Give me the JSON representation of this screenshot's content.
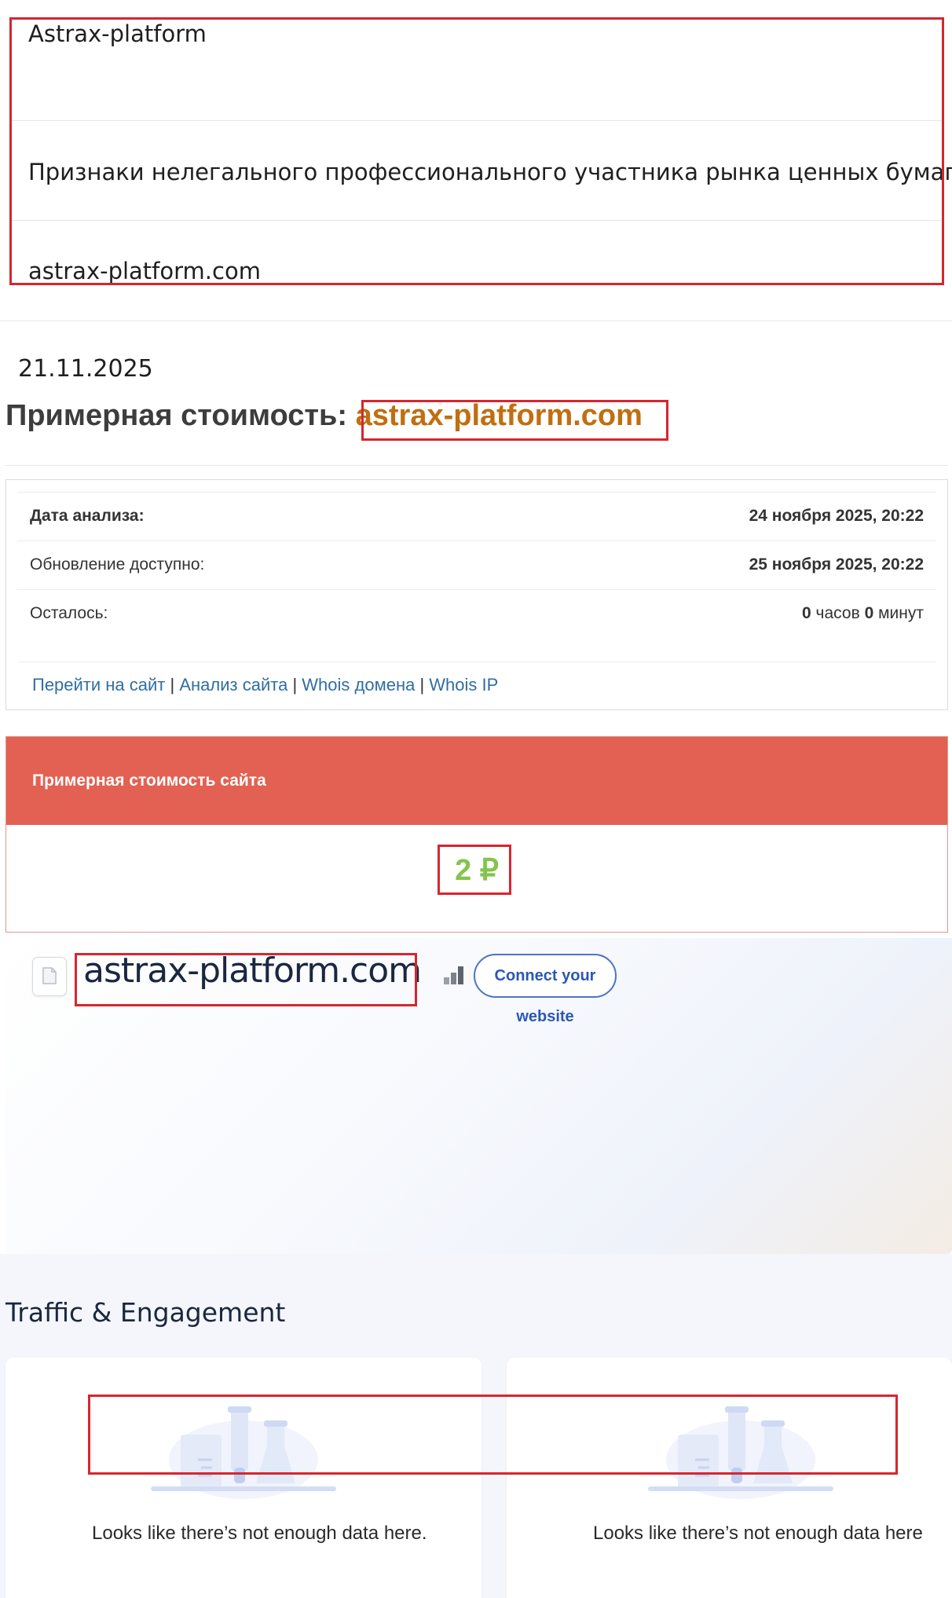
{
  "info": {
    "name": "Astrax-platform",
    "reason": "Признаки нелегального профессионального участника рынка ценных бумаг",
    "domain": "astrax-platform.com"
  },
  "post": {
    "date": "21.11.2025",
    "heading_prefix": "Примерная стоимость: ",
    "heading_domain": "astrax-platform.com"
  },
  "analysis": {
    "rows": [
      {
        "label": "Дата анализа:",
        "value": "24 ноября 2025, 20:22"
      },
      {
        "label": "Обновление доступно:",
        "value": "25 ноября 2025, 20:22"
      },
      {
        "label": "Осталось:",
        "hours_num": "0",
        "hours_word": " часов ",
        "minutes_num": "0",
        "minutes_word": " минут"
      }
    ],
    "links": [
      "Перейти на сайт",
      "Анализ сайта",
      "Whois домена",
      "Whois IP"
    ],
    "separator": " | "
  },
  "price": {
    "title": "Примерная стоимость сайта",
    "value": "2 ₽"
  },
  "website": {
    "domain": "astrax-platform.com",
    "favicon_icon": "document-icon",
    "rank_icon": "bar-chart-icon",
    "connect_label": "Connect your website"
  },
  "traffic": {
    "title": "Traffic & Engagement",
    "cards": [
      {
        "illustration": "lab-flask-icon",
        "message": "Looks like there’s not enough data here."
      },
      {
        "illustration": "lab-flask-icon",
        "message": "Looks like there’s not enough data here"
      }
    ]
  },
  "colors": {
    "highlight": "#d6262f",
    "heading_domain": "#c06f10",
    "price_header": "#e36152",
    "price_value": "#84c44d",
    "link": "#2f6ea3",
    "connect_button": "#2c57b3"
  }
}
